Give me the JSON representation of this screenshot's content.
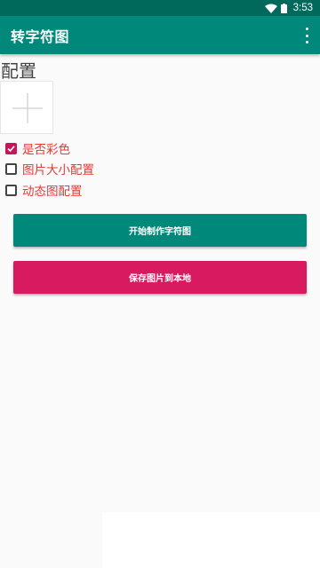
{
  "status_bar": {
    "time": "3:53",
    "icons": [
      "wifi-icon",
      "battery-icon"
    ]
  },
  "app_bar": {
    "title": "转字符图",
    "menu_icon": "overflow-menu-icon"
  },
  "content": {
    "heading": "配置",
    "add_image_icon": "plus-icon",
    "options": [
      {
        "label": "是否彩色",
        "checked": true
      },
      {
        "label": "图片大小配置",
        "checked": false
      },
      {
        "label": "动态图配置",
        "checked": false
      }
    ],
    "buttons": {
      "start": "开始制作字符图",
      "save": "保存图片到本地"
    }
  },
  "colors": {
    "primary": "#00897b",
    "primary_dark": "#00695c",
    "accent": "#d81b60",
    "checkbox_checked": "#c2185b",
    "option_text": "#e53935"
  }
}
